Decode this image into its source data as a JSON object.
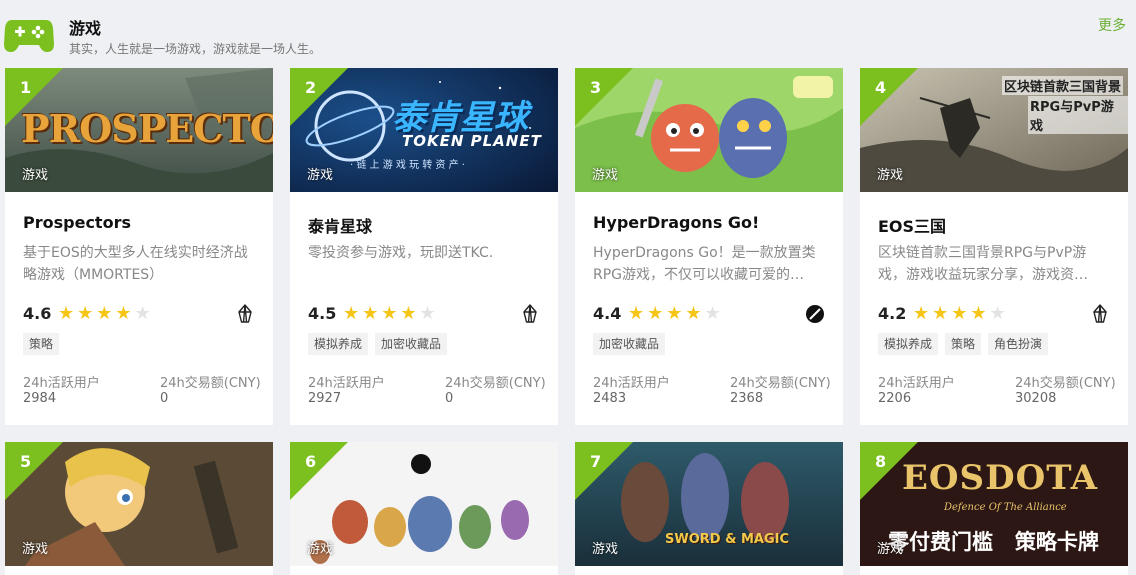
{
  "section": {
    "title": "游戏",
    "subtitle": "其实，人生就是一场游戏，游戏就是一场人生。",
    "more": "更多"
  },
  "labels": {
    "active_users": "24h活跃用户",
    "volume": "24h交易额(CNY)"
  },
  "colors": {
    "accent": "#7cc01f",
    "star": "#f5c518",
    "link": "#6cb033"
  },
  "cards": [
    {
      "rank": "1",
      "category": "游戏",
      "banner_text": "PROSPECTORS",
      "name": "Prospectors",
      "desc": "基于EOS的大型多人在线实时经济战略游戏（MMORTES）",
      "rating": "4.6",
      "chain_icon": "eos-icon",
      "tags": [
        "策略"
      ],
      "active": "2984",
      "volume": "0"
    },
    {
      "rank": "2",
      "category": "游戏",
      "banner_text": "泰肯星球",
      "banner_sub": "TOKEN PLANET",
      "banner_sub2": "· 链 上 游 戏   玩 转 资 产 ·",
      "name": "泰肯星球",
      "desc": "零投资参与游戏，玩即送TKC.",
      "rating": "4.5",
      "chain_icon": "eos-icon",
      "tags": [
        "模拟养成",
        "加密收藏品"
      ],
      "active": "2927",
      "volume": "0"
    },
    {
      "rank": "3",
      "category": "游戏",
      "name": "HyperDragons Go!",
      "desc": "HyperDragons Go！是一款放置类RPG游戏，不仅可以收藏可爱的…",
      "rating": "4.4",
      "chain_icon": "ontology-icon",
      "tags": [
        "加密收藏品"
      ],
      "active": "2483",
      "volume": "2368"
    },
    {
      "rank": "4",
      "category": "游戏",
      "banner_text": "区块链首款三国背景",
      "banner_sub": "RPG与PvP游戏",
      "name": "EOS三国",
      "desc": "区块链首款三国背景RPG与PvP游戏，游戏收益玩家分享，游戏资…",
      "rating": "4.2",
      "chain_icon": "eos-icon",
      "tags": [
        "模拟养成",
        "策略",
        "角色扮演"
      ],
      "active": "2206",
      "volume": "30208"
    },
    {
      "rank": "5",
      "category": "游戏"
    },
    {
      "rank": "6",
      "category": "游戏"
    },
    {
      "rank": "7",
      "category": "游戏",
      "banner_text": "SWORD & MAGIC"
    },
    {
      "rank": "8",
      "category": "游戏",
      "banner_text": "EOSDOTA",
      "banner_sub": "Defence Of The Alliance",
      "banner_sub2": "零付费门槛   策略卡牌"
    }
  ]
}
